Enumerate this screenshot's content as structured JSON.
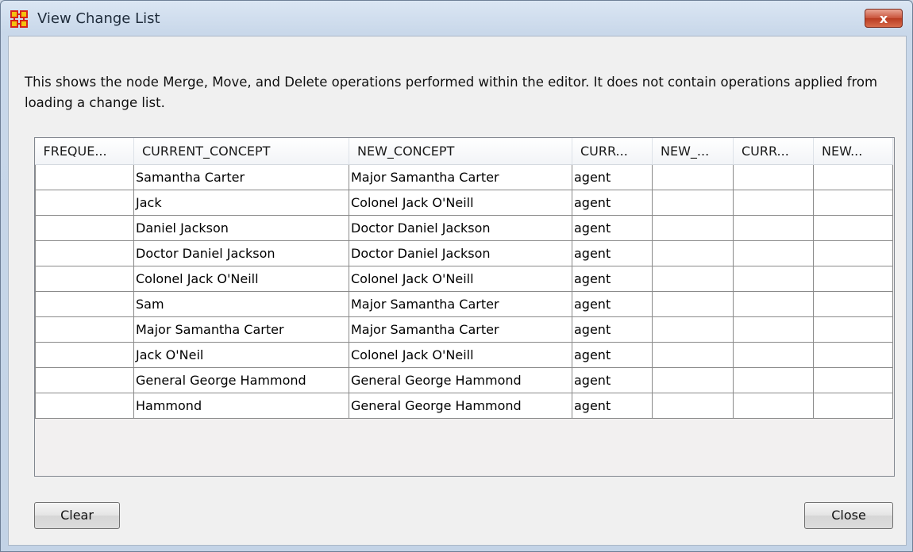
{
  "window": {
    "title": "View Change List",
    "close_glyph": "x",
    "app_icon": "network-nodes-icon"
  },
  "description": "This shows the node Merge, Move, and Delete operations performed within the editor. It does not contain operations applied from loading a change list.",
  "table": {
    "columns": [
      "FREQUE...",
      "CURRENT_CONCEPT",
      "NEW_CONCEPT",
      "CURR...",
      "NEW_...",
      "CURR...",
      "NEW..."
    ],
    "rows": [
      [
        "",
        "Samantha Carter",
        "Major Samantha Carter",
        "agent",
        "",
        "",
        ""
      ],
      [
        "",
        "Jack",
        "Colonel Jack O'Neill",
        "agent",
        "",
        "",
        ""
      ],
      [
        "",
        "Daniel Jackson",
        "Doctor Daniel Jackson",
        "agent",
        "",
        "",
        ""
      ],
      [
        "",
        "Doctor Daniel Jackson",
        "Doctor Daniel Jackson",
        "agent",
        "",
        "",
        ""
      ],
      [
        "",
        "Colonel Jack O'Neill",
        "Colonel Jack O'Neill",
        "agent",
        "",
        "",
        ""
      ],
      [
        "",
        "Sam",
        "Major Samantha Carter",
        "agent",
        "",
        "",
        ""
      ],
      [
        "",
        "Major Samantha Carter",
        "Major Samantha Carter",
        "agent",
        "",
        "",
        ""
      ],
      [
        "",
        "Jack O'Neil",
        "Colonel Jack O'Neill",
        "agent",
        "",
        "",
        ""
      ],
      [
        "",
        "General George Hammond",
        "General George Hammond",
        "agent",
        "",
        "",
        ""
      ],
      [
        "",
        "Hammond",
        "General George Hammond",
        "agent",
        "",
        "",
        ""
      ]
    ]
  },
  "buttons": {
    "clear": "Clear",
    "close": "Close"
  },
  "colors": {
    "icon_red": "#d8231a",
    "icon_yellow": "#f4c20d",
    "close_button_red": "#c9523a"
  }
}
